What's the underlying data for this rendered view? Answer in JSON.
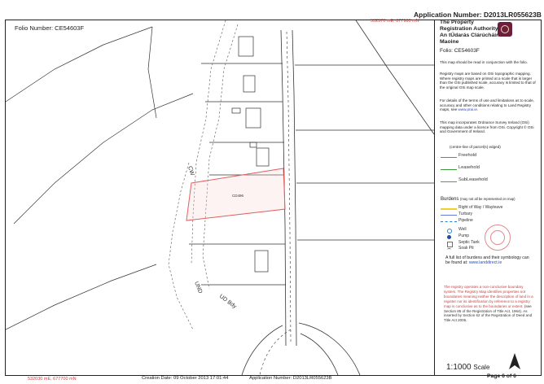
{
  "header": {
    "application_number": "Application Number: D2013LR055623B",
    "folio": "Folio Number: CE54603F",
    "coordinate_top": "532370 mE, 677960 mN"
  },
  "map": {
    "labels": [
      {
        "id": "cw",
        "text": "CW"
      },
      {
        "id": "und",
        "text": "UND"
      },
      {
        "id": "ud-bdy",
        "text": "UD Bdy"
      },
      {
        "id": "parcel",
        "text": "CD496"
      }
    ],
    "coordinate_bottom": "532030 mE, 677700 mN",
    "colors": {
      "freehold": "#e05050",
      "leasehold": "#3a9a3a",
      "subleasehold": "#d04ab0",
      "right_of_way": "#f2cf2a",
      "turbary": "#6a7ad8",
      "pipeline": "#2a7fd0"
    }
  },
  "legend": {
    "authority_title": "The Property Registration Authority",
    "authority_irish": "An tÚdarás Clárúcháin Maoine",
    "folio": "Folio:   CE54603F",
    "notes": [
      "This map should be read in conjunction with the folio.",
      "Registry maps are based on OSi topographic mapping. Where registry maps are printed at a scale that is larger than the OSi published scale, accuracy is limited to that of the original OSi map scale.",
      "For details of the terms of use and limitations as to scale, accuracy and other conditions relating to Land Registry maps, see",
      "This map incorporates Ordnance Survey Ireland (OSi) mapping data under a licence from OSi. Copyright © OSi and Government of Ireland."
    ],
    "prai_link": "www.prai.ie.",
    "edge_note": "(centre-line of parcel(s) edged)",
    "tenure": [
      {
        "label": "Freehold",
        "color": "#e05050"
      },
      {
        "label": "Leasehold",
        "color": "#3a9a3a"
      },
      {
        "label": "SubLeasehold",
        "color": "#d04ab0"
      }
    ],
    "burdens_title": "Burdens",
    "burdens_subtitle": "(may not all be represented on map)",
    "burdens": [
      {
        "label": "Right of Way / Wayleave",
        "color": "#f2cf2a"
      },
      {
        "label": "Turbary",
        "color": "#6a7ad8"
      },
      {
        "label": "Pipeline",
        "color": "#2a7fd0"
      }
    ],
    "symbols": [
      "Well",
      "Pump",
      "Septic Tank",
      "Soak Pit"
    ],
    "burden_list_text": "A full list of burdens and their symbology can be found at:",
    "burden_link": "www.landdirect.ie",
    "registry_note": "The registry operates a non-conclusive boundary system. The Registry Map identifies properties not boundaries meaning neither the description of land in a register nor its identification by reference to a registry map is conclusive as to the boundaries or extent.",
    "registry_note_ref": "(see Section 85 of the Registration of Title Act, 1964). As inserted by Section 62 of the Registration of Deed and Title Act 2006.",
    "scale": "1:1000",
    "scale_unit": "Scale",
    "page": "Page 6 of 6"
  },
  "footer": {
    "creation_date": "Creation Date: 09 October 2013 17:01:44",
    "application_number": "Application Number:    D2013LR055623B"
  }
}
